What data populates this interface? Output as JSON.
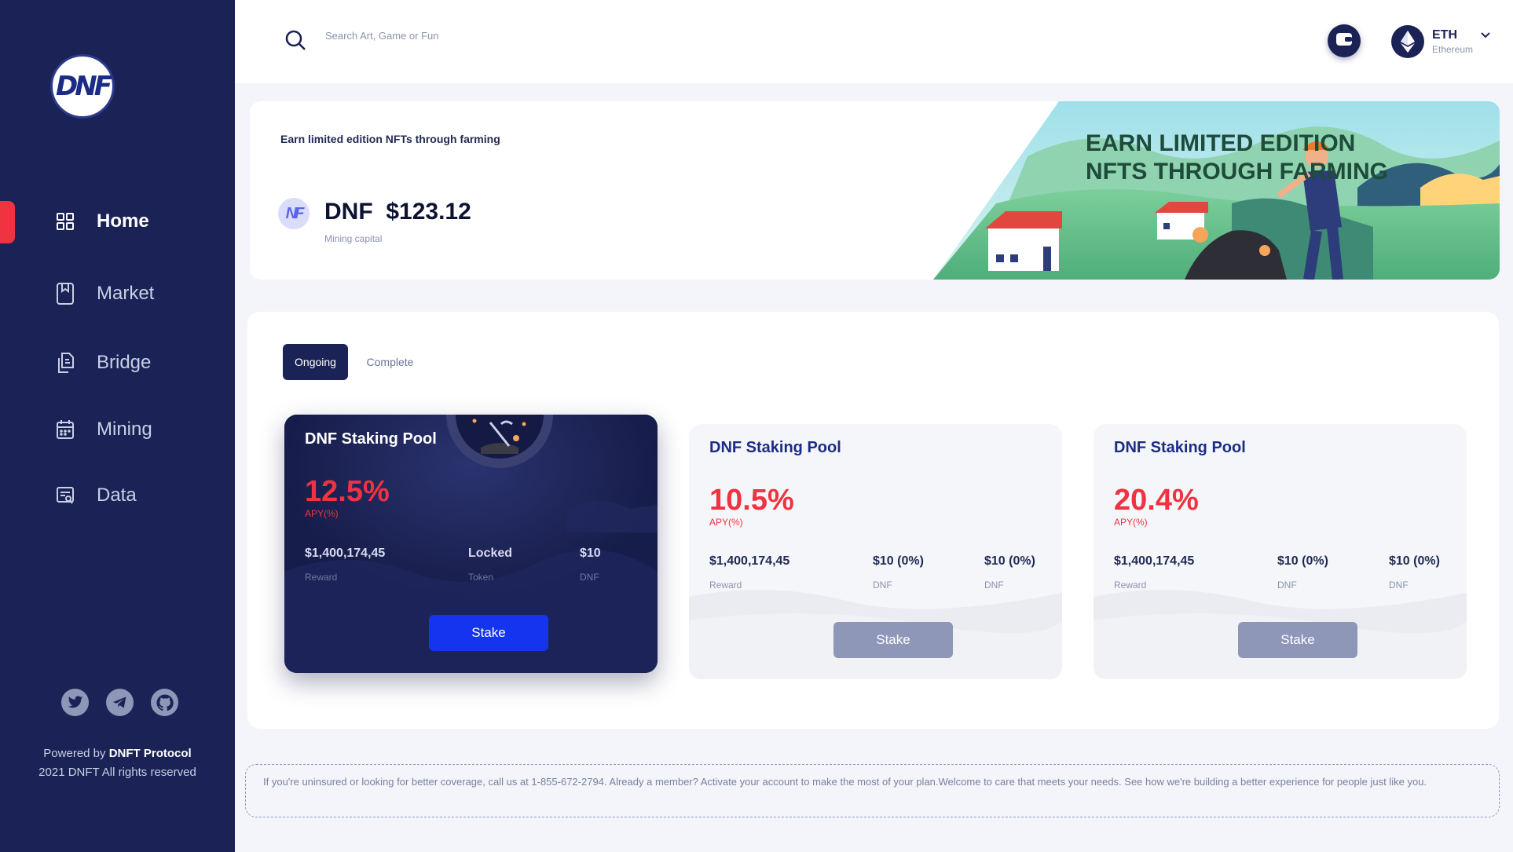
{
  "sidebar": {
    "logo_text": "DNF",
    "items": [
      {
        "label": "Home",
        "icon": "grid-icon",
        "active": true
      },
      {
        "label": "Market",
        "icon": "bookmark-icon"
      },
      {
        "label": "Bridge",
        "icon": "copy-icon"
      },
      {
        "label": "Mining",
        "icon": "calendar-icon"
      },
      {
        "label": "Data",
        "icon": "report-icon"
      }
    ],
    "socials": [
      "twitter-icon",
      "telegram-icon",
      "github-icon"
    ],
    "powered_prefix": "Powered by ",
    "powered_brand": "DNFT Protocol",
    "copyright": "2021 DNFT All rights reserved"
  },
  "header": {
    "search_placeholder": "Search Art, Game or Fun",
    "currency_symbol": "ETH",
    "currency_name": "Ethereum"
  },
  "banner": {
    "subtitle": "Earn limited edition NFTs through farming",
    "badge_text": "NF",
    "price": "DNF  $123.12",
    "price_label": "Mining capital",
    "art_title_line1": "EARN LIMITED EDITION",
    "art_title_line2": "NFTS THROUGH FARMING"
  },
  "tabs": {
    "ongoing": "Ongoing",
    "complete": "Complete"
  },
  "pools": [
    {
      "title": "DNF Staking Pool",
      "apy": "12.5%",
      "apy_label": "APY(%)",
      "stats": [
        {
          "value": "$1,400,174,45",
          "label": "Reward"
        },
        {
          "value": "Locked",
          "label": "Token"
        },
        {
          "value": "$10",
          "label": "DNF"
        }
      ],
      "button": "Stake"
    },
    {
      "title": "DNF Staking Pool",
      "apy": "10.5%",
      "apy_label": "APY(%)",
      "stats": [
        {
          "value": "$1,400,174,45",
          "label": "Reward"
        },
        {
          "value": "$10 (0%)",
          "label": "DNF"
        },
        {
          "value": "$10 (0%)",
          "label": "DNF"
        }
      ],
      "button": "Stake"
    },
    {
      "title": "DNF Staking Pool",
      "apy": "20.4%",
      "apy_label": "APY(%)",
      "stats": [
        {
          "value": "$1,400,174,45",
          "label": "Reward"
        },
        {
          "value": "$10 (0%)",
          "label": "DNF"
        },
        {
          "value": "$10 (0%)",
          "label": "DNF"
        }
      ],
      "button": "Stake"
    }
  ],
  "disclaimer": "If you're uninsured or looking for better coverage, call us at 1-855-672-2794. Already a member? Activate your account to make the most of your plan.Welcome to care that meets your needs. See how we're building a better experience for people just like you.",
  "colors": {
    "sidebar": "#1b2356",
    "accent_red": "#ef3340",
    "stake_blue": "#1434f0",
    "stake_disabled": "#8e97b8"
  }
}
